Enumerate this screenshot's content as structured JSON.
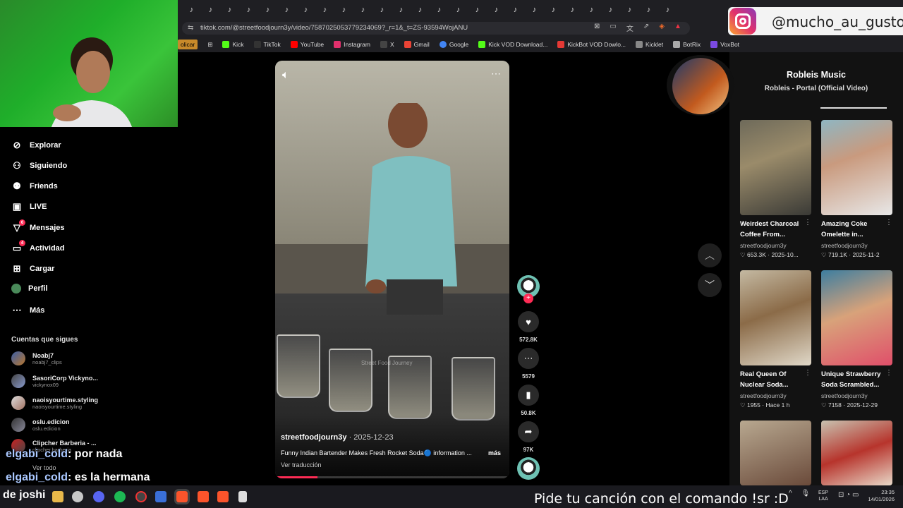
{
  "browser": {
    "url": "tiktok.com/@streetfoodjourn3y/video/7587025053779234069?_r=1&_t=ZS-93594WojANU",
    "tab_icon": "tiktok-icon",
    "bookmarks": [
      {
        "label": "olicar",
        "color": "#c88a2a"
      },
      {
        "label": "Kick",
        "color": "#53fc18"
      },
      {
        "label": "TikTok",
        "color": "#111111"
      },
      {
        "label": "YouTube",
        "color": "#ff0000"
      },
      {
        "label": "Instagram",
        "color": "#e1306c"
      },
      {
        "label": "X",
        "color": "#000000"
      },
      {
        "label": "Gmail",
        "color": "#ea4335"
      },
      {
        "label": "Google",
        "color": "#4285f4"
      },
      {
        "label": "Kick VOD Download...",
        "color": "#53fc18"
      },
      {
        "label": "KickBot VOD Dowlo...",
        "color": "#e53935"
      },
      {
        "label": "Kicklet",
        "color": "#888888"
      },
      {
        "label": "BotRix",
        "color": "#aaaaaa"
      },
      {
        "label": "VoxBot",
        "color": "#7b4ae2"
      }
    ]
  },
  "overlay": {
    "instagram_handle": "@mucho_au_gusto"
  },
  "sidebar": {
    "nav": [
      {
        "label": "Explorar",
        "icon": "compass-icon",
        "badge": ""
      },
      {
        "label": "Siguiendo",
        "icon": "following-icon",
        "badge": ""
      },
      {
        "label": "Friends",
        "icon": "friends-icon",
        "badge": ""
      },
      {
        "label": "LIVE",
        "icon": "live-icon",
        "badge": ""
      },
      {
        "label": "Mensajes",
        "icon": "messages-icon",
        "badge": "6"
      },
      {
        "label": "Actividad",
        "icon": "activity-icon",
        "badge": "4"
      },
      {
        "label": "Cargar",
        "icon": "upload-icon",
        "badge": ""
      },
      {
        "label": "Perfil",
        "icon": "profile-icon",
        "badge": ""
      },
      {
        "label": "Más",
        "icon": "more-icon",
        "badge": ""
      }
    ],
    "follows_title": "Cuentas que sigues",
    "accounts": [
      {
        "name": "Noabj7",
        "user": "noabj7_clips"
      },
      {
        "name": "SasoriCorp Vickyno...",
        "user": "vickynox09"
      },
      {
        "name": "naoisyourtime.styling",
        "user": "naoisyourtime.styling"
      },
      {
        "name": "oslu.edicion",
        "user": "oslu.edicion"
      },
      {
        "name": "Clipcher Barberia - ...",
        "user": "clipcher.barberia"
      }
    ],
    "see_all": "Ver todo"
  },
  "chat": [
    {
      "user": "elgabi_cold",
      "msg": ": por nada"
    },
    {
      "user": "elgabi_cold",
      "msg": ": es la hermana"
    }
  ],
  "video": {
    "author": "streetfoodjourn3y",
    "date": "· 2025-12-23",
    "description": "Funny Indian Bartender Makes Fresh Rocket Soda🔵 information ...",
    "more": "más",
    "translate": "Ver traducción",
    "watermark": "Street Food Journey",
    "progress_fraction": 0.18,
    "likes": "572.8K",
    "comments": "5579",
    "saves": "50.8K",
    "shares": "97K"
  },
  "music": {
    "title": "Robleis Music",
    "subtitle": "Robleis - Portal (Official Video)"
  },
  "related": [
    {
      "title1": "Weirdest Charcoal",
      "title2": "Coffee From...",
      "author": "streetfoodjourn3y",
      "stats": "♡ 653.3K · 2025-10..."
    },
    {
      "title1": "Amazing Coke",
      "title2": "Omelette in...",
      "author": "streetfoodjourn3y",
      "stats": "♡ 719.1K · 2025-11-2"
    },
    {
      "title1": "Real Queen Of",
      "title2": "Nuclear Soda...",
      "author": "streetfoodjourn3y",
      "stats": "♡ 1955 · Hace 1 h"
    },
    {
      "title1": "Unique Strawberry",
      "title2": "Soda Scrambled...",
      "author": "streetfoodjourn3y",
      "stats": "♡ 7158 · 2025-12-29"
    }
  ],
  "taskbar": {
    "user": "de joshi",
    "song_prompt": "Pide tu canción con el comando !sr :D",
    "lang1": "ESP",
    "lang2": "LAA",
    "time": "23:35",
    "date": "14/01/2026"
  }
}
